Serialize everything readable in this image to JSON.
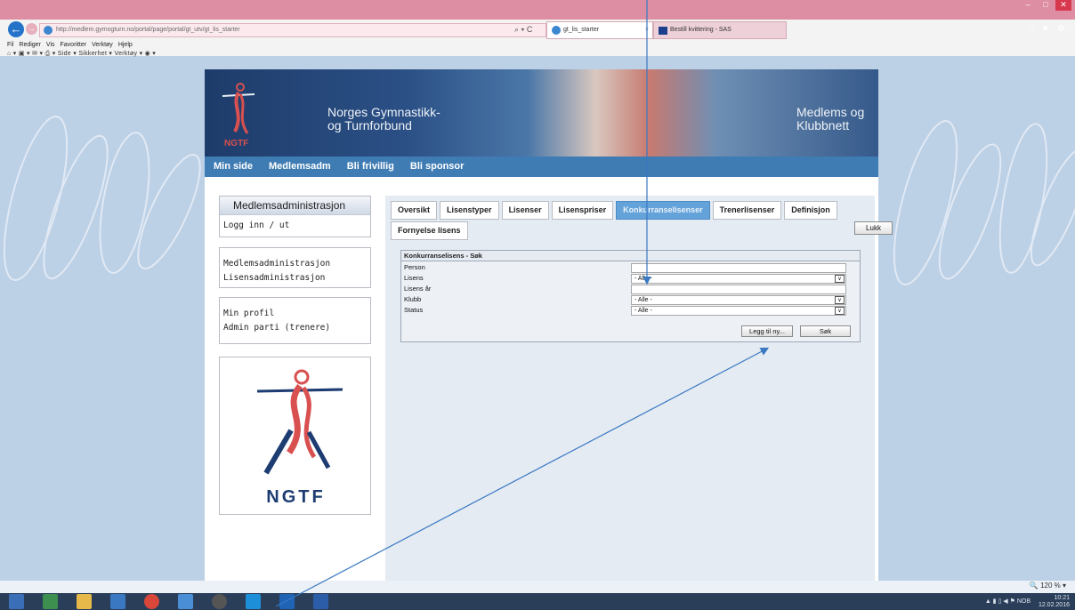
{
  "browser": {
    "url": "http://medlem.gymogturn.no/portal/page/portal/gt_utv/gt_lis_starter",
    "address_controls": "⌕ ▾ C",
    "tabs": [
      {
        "label": "gt_lis_starter",
        "close": "×"
      },
      {
        "label": "Bestill kvittering - SAS"
      }
    ],
    "menu": [
      "Fil",
      "Rediger",
      "Vis",
      "Favoritter",
      "Verktøy",
      "Hjelp"
    ],
    "command_bar": [
      "Side ▾",
      "Sikkerhet ▾",
      "Verktøy ▾"
    ],
    "window_buttons": [
      "–",
      "□",
      "✕"
    ],
    "toolbar_right": "⌂ ★ ⚙",
    "back_glyph": "←",
    "forward_glyph": "→"
  },
  "site": {
    "banner_title": [
      "Norges Gymnastikk-",
      "og Turnforbund"
    ],
    "banner_right": [
      "Medlems og",
      "Klubbnett"
    ],
    "logo_text": "NGTF",
    "nav": [
      "Min side",
      "Medlemsadm",
      "Bli frivillig",
      "Bli sponsor"
    ]
  },
  "sidebar": {
    "header": "Medlemsadministrasjon",
    "login": "Logg inn / ut",
    "group1": [
      "Medlemsadministrasjon",
      "Lisensadministrasjon"
    ],
    "group2": [
      "Min profil",
      "Admin parti (trenere)"
    ],
    "logo_text": "NGTF"
  },
  "tabs": {
    "row1": [
      "Oversikt",
      "Lisenstyper",
      "Lisenser",
      "Lisenspriser",
      "Konkurranselisenser",
      "Trenerlisenser",
      "Definisjon"
    ],
    "row2": [
      "Fornyelse lisens"
    ],
    "active": "Konkurranselisenser",
    "close_label": "Lukk"
  },
  "search": {
    "title": "Konkurranselisens - Søk",
    "fields": [
      {
        "label": "Person",
        "kind": "text",
        "value": ""
      },
      {
        "label": "Lisens",
        "kind": "select",
        "value": "- Alle -"
      },
      {
        "label": "Lisens år",
        "kind": "text",
        "value": ""
      },
      {
        "label": "Klubb",
        "kind": "select",
        "value": "- Alle -"
      },
      {
        "label": "Status",
        "kind": "select",
        "value": "- Alle -"
      }
    ],
    "add_button": "Legg til ny...",
    "search_button": "Søk",
    "dropdown_glyph": "∨"
  },
  "status": {
    "zoom": "120 %",
    "tray_lang": "NOB",
    "time": "10:21",
    "date": "12.02.2016"
  },
  "colors": {
    "titlebar": "#dd8ea3",
    "nav": "#3f7cb3",
    "active_tab": "#64a3d9",
    "arrow": "#3a78c2"
  }
}
